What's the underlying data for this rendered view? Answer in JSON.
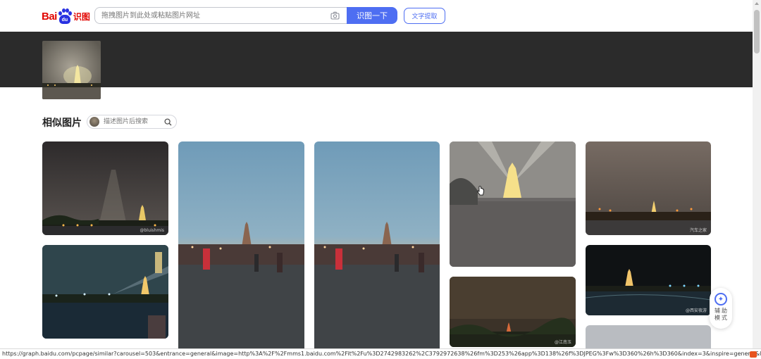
{
  "header": {
    "logo_text_bai": "Bai",
    "logo_text_du": "du",
    "logo_text_shitu": "识图",
    "search_placeholder": "拖拽图片到此处或粘贴图片网址",
    "submit_label": "识图一下",
    "text_extract_label": "文字提取"
  },
  "similar": {
    "title": "相似图片",
    "search_placeholder": "描述图片后搜索"
  },
  "results": [
    {
      "label": "",
      "watermark": "@bluishmis"
    },
    {
      "label": "",
      "watermark": ""
    },
    {
      "label": "",
      "watermark": ""
    },
    {
      "label": "",
      "watermark": ""
    },
    {
      "label": "",
      "watermark": "汽车之家"
    },
    {
      "label": "",
      "watermark": ""
    },
    {
      "label": "",
      "watermark": "@江南玉"
    },
    {
      "label": "",
      "watermark": "@西安夜游"
    },
    {
      "label": "",
      "watermark": ""
    }
  ],
  "assist": {
    "label": "辅助模式"
  },
  "status_url": "https://graph.baidu.com/pcpage/similar?carousel=503&entrance=general&image=http%3A%2F%2Fmms1.baidu.com%2Fit%2Fu%3D2742983262%2C3792972638%26fm%3D253%26app%3D138%26f%3DJPEG%3Fw%3D360%26h%3D360&index=3&inspire=general&limit=30&originS...",
  "colors": {
    "accent": "#4e6ef2",
    "logo_red": "#e10602",
    "dark_band": "#2b2b2b"
  },
  "icons": {
    "camera": "camera-icon",
    "search": "search-icon",
    "assist": "accessibility-icon"
  }
}
